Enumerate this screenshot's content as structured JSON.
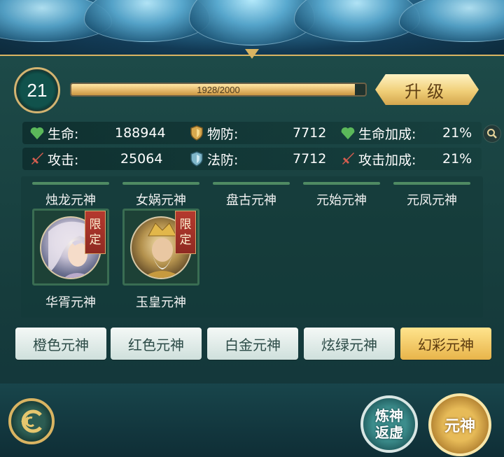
{
  "level": {
    "value": "21",
    "exp_text": "1928/2000",
    "exp_fraction": 0.964,
    "upgrade_label": "升级"
  },
  "stats": {
    "row1": [
      {
        "icon": "heart-icon",
        "label": "生命:",
        "value": "188944"
      },
      {
        "icon": "shield-icon",
        "label": "物防:",
        "value": "7712"
      },
      {
        "icon": "heart-icon",
        "label": "生命加成:",
        "value": "21%"
      }
    ],
    "row2": [
      {
        "icon": "sword-icon",
        "label": "攻击:",
        "value": "25064"
      },
      {
        "icon": "magic-shield-icon",
        "label": "法防:",
        "value": "7712"
      },
      {
        "icon": "sword-icon",
        "label": "攻击加成:",
        "value": "21%"
      }
    ]
  },
  "slots_top": [
    "烛龙元神",
    "女娲元神",
    "盘古元神",
    "元始元神",
    "元凤元神"
  ],
  "cards": [
    {
      "name": "华胥元神",
      "tag": [
        "限",
        "定"
      ]
    },
    {
      "name": "玉皇元神",
      "tag": [
        "限",
        "定"
      ]
    }
  ],
  "tabs": [
    {
      "label": "橙色元神",
      "active": false
    },
    {
      "label": "红色元神",
      "active": false
    },
    {
      "label": "白金元神",
      "active": false
    },
    {
      "label": "炫绿元神",
      "active": false
    },
    {
      "label": "幻彩元神",
      "active": true
    }
  ],
  "bottom": {
    "refine_label_1": "炼神",
    "refine_label_2": "返虚",
    "soul_label": "元神"
  },
  "colors": {
    "gold": "#d9b462",
    "panel": "#1d4a48",
    "active_tab": "#e8b44a"
  }
}
